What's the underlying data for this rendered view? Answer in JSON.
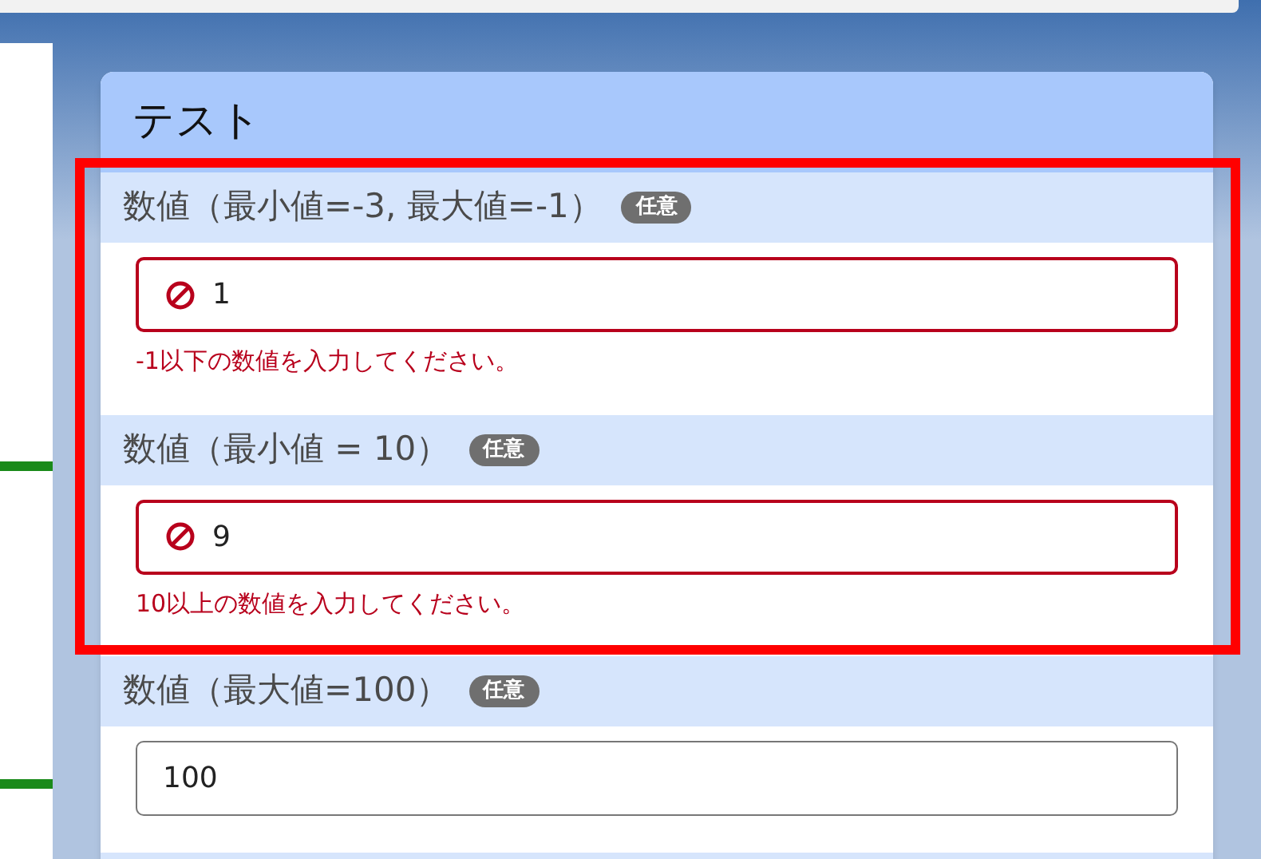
{
  "card": {
    "title": "テスト"
  },
  "fields": [
    {
      "label": "数値（最小値=-3, 最大値=-1）",
      "badge": "任意",
      "value": "1",
      "invalid": true,
      "error": "-1以下の数値を入力してください。"
    },
    {
      "label": "数値（最小値 = 10）",
      "badge": "任意",
      "value": "9",
      "invalid": true,
      "error": "10以上の数値を入力してください。"
    },
    {
      "label": "数値（最大値=100）",
      "badge": "任意",
      "value": "100",
      "invalid": false
    }
  ]
}
